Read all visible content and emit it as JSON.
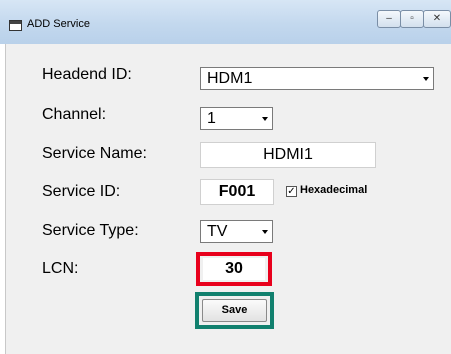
{
  "window": {
    "title": "ADD Service",
    "minimize_glyph": "–",
    "maximize_glyph": "▫",
    "close_glyph": "✕"
  },
  "form": {
    "headend": {
      "label": "Headend ID:",
      "value": "HDM1"
    },
    "channel": {
      "label": "Channel:",
      "value": "1"
    },
    "service_name": {
      "label": "Service Name:",
      "value": "HDMI1"
    },
    "service_id": {
      "label": "Service ID:",
      "value": "F001",
      "hex_label": "Hexadecimal",
      "hex_checked": true,
      "check_glyph": "✓"
    },
    "service_type": {
      "label": "Service Type:",
      "value": "TV"
    },
    "lcn": {
      "label": "LCN:",
      "value": "30"
    },
    "save_label": "Save"
  },
  "highlight_colors": {
    "lcn": "#e8001c",
    "save": "#11806e"
  }
}
